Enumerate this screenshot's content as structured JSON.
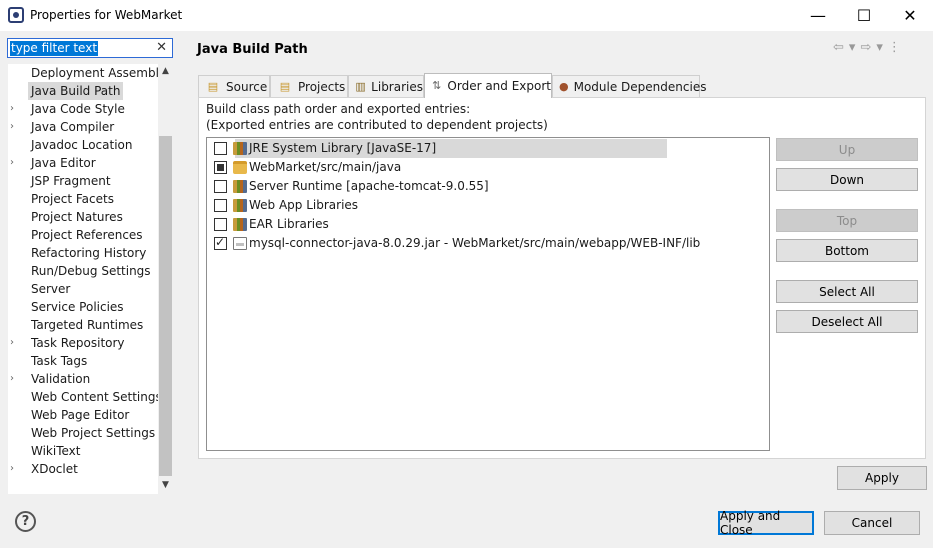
{
  "window": {
    "title": "Properties for WebMarket",
    "minimize": "—",
    "maximize": "☐",
    "close": "✕"
  },
  "filter": {
    "value": "type filter text",
    "clear": "✕"
  },
  "tree": {
    "scroll_up": "▲",
    "scroll_down": "▼",
    "items": [
      {
        "label": "Deployment Assembly",
        "expander": ""
      },
      {
        "label": "Java Build Path",
        "expander": "",
        "selected": true
      },
      {
        "label": "Java Code Style",
        "expander": "›"
      },
      {
        "label": "Java Compiler",
        "expander": "›"
      },
      {
        "label": "Javadoc Location",
        "expander": ""
      },
      {
        "label": "Java Editor",
        "expander": "›"
      },
      {
        "label": "JSP Fragment",
        "expander": ""
      },
      {
        "label": "Project Facets",
        "expander": ""
      },
      {
        "label": "Project Natures",
        "expander": ""
      },
      {
        "label": "Project References",
        "expander": ""
      },
      {
        "label": "Refactoring History",
        "expander": ""
      },
      {
        "label": "Run/Debug Settings",
        "expander": ""
      },
      {
        "label": "Server",
        "expander": ""
      },
      {
        "label": "Service Policies",
        "expander": ""
      },
      {
        "label": "Targeted Runtimes",
        "expander": ""
      },
      {
        "label": "Task Repository",
        "expander": "›"
      },
      {
        "label": "Task Tags",
        "expander": ""
      },
      {
        "label": "Validation",
        "expander": "›"
      },
      {
        "label": "Web Content Settings",
        "expander": ""
      },
      {
        "label": "Web Page Editor",
        "expander": ""
      },
      {
        "label": "Web Project Settings",
        "expander": ""
      },
      {
        "label": "WikiText",
        "expander": ""
      },
      {
        "label": "XDoclet",
        "expander": "›"
      }
    ]
  },
  "page": {
    "title": "Java Build Path",
    "nav": {
      "back": "⇦",
      "back_menu": "▾",
      "forward": "⇨",
      "forward_menu": "▾",
      "more": "⋮"
    }
  },
  "tabs": [
    {
      "label": "Source",
      "icon": "source-folder-icon",
      "glyph": "▤"
    },
    {
      "label": "Projects",
      "icon": "projects-folder-icon",
      "glyph": "▤"
    },
    {
      "label": "Libraries",
      "icon": "libraries-icon",
      "glyph": "▥"
    },
    {
      "label": "Order and Export",
      "icon": "order-export-icon",
      "glyph": "⇅",
      "active": true
    },
    {
      "label": "Module Dependencies",
      "icon": "module-icon",
      "glyph": "●"
    }
  ],
  "description": {
    "line1": "Build class path order and exported entries:",
    "line2": "(Exported entries are contributed to dependent projects)"
  },
  "entries": [
    {
      "label": "JRE System Library [JavaSE-17]",
      "icon": "library-icon",
      "state": "unchecked",
      "selected": true
    },
    {
      "label": "WebMarket/src/main/java",
      "icon": "source-folder-icon",
      "state": "partial"
    },
    {
      "label": "Server Runtime [apache-tomcat-9.0.55]",
      "icon": "library-icon",
      "state": "unchecked"
    },
    {
      "label": "Web App Libraries",
      "icon": "library-icon",
      "state": "unchecked"
    },
    {
      "label": "EAR Libraries",
      "icon": "library-icon",
      "state": "unchecked"
    },
    {
      "label": "mysql-connector-java-8.0.29.jar - WebMarket/src/main/webapp/WEB-INF/lib",
      "icon": "jar-icon",
      "state": "checked"
    }
  ],
  "buttons": {
    "up": "Up",
    "down": "Down",
    "top": "Top",
    "bottom": "Bottom",
    "select_all": "Select All",
    "deselect_all": "Deselect All",
    "apply": "Apply",
    "apply_close": "Apply and Close",
    "cancel": "Cancel",
    "help": "?"
  }
}
